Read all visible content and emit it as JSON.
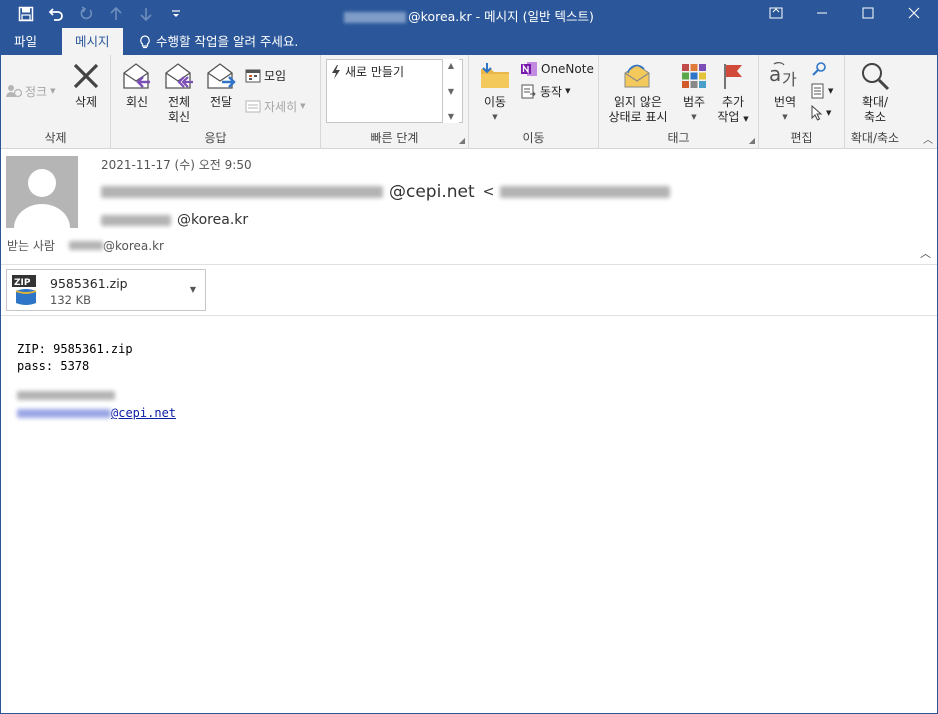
{
  "titlebar": {
    "title_domain": "@korea.kr",
    "title_suffix": " - 메시지 (일반 텍스트)"
  },
  "tabs": {
    "file": "파일",
    "message": "메시지",
    "tellme": "수행할 작업을 알려 주세요."
  },
  "ribbon": {
    "delete_group": {
      "junk": "정크",
      "delete": "삭제",
      "label": "삭제"
    },
    "respond_group": {
      "reply": "회신",
      "reply_all_1": "전체",
      "reply_all_2": "회신",
      "forward": "전달",
      "meeting": "모임",
      "more": "자세히",
      "label": "응답"
    },
    "quicksteps_group": {
      "create_new": "새로 만들기",
      "label": "빠른 단계"
    },
    "move_group": {
      "move": "이동",
      "onenote": "OneNote",
      "actions": "동작",
      "label": "이동"
    },
    "tags_group": {
      "unread_1": "읽지 않은",
      "unread_2": "상태로 표시",
      "categorize": "범주",
      "followup_1": "추가",
      "followup_2": "작업",
      "label": "태그"
    },
    "editing_group": {
      "translate": "번역",
      "label": "편집"
    },
    "zoom_group": {
      "zoom_1": "확대/",
      "zoom_2": "축소",
      "label": "확대/축소"
    }
  },
  "header": {
    "date": "2021-11-17 (수) 오전 9:50",
    "from_domain": "@cepi.net",
    "from_bracket": "<",
    "to_domain": "@korea.kr",
    "recipient_label": "받는 사람",
    "recipient_domain": "@korea.kr"
  },
  "attachment": {
    "name": "9585361.zip",
    "size": "132 KB",
    "badge": "ZIP"
  },
  "body": {
    "line1": "ZIP: 9585361.zip",
    "line2": "pass: 5378",
    "link_domain": "@cepi.net"
  },
  "colors": {
    "accent": "#2b579a",
    "link": "#0b1da3"
  }
}
